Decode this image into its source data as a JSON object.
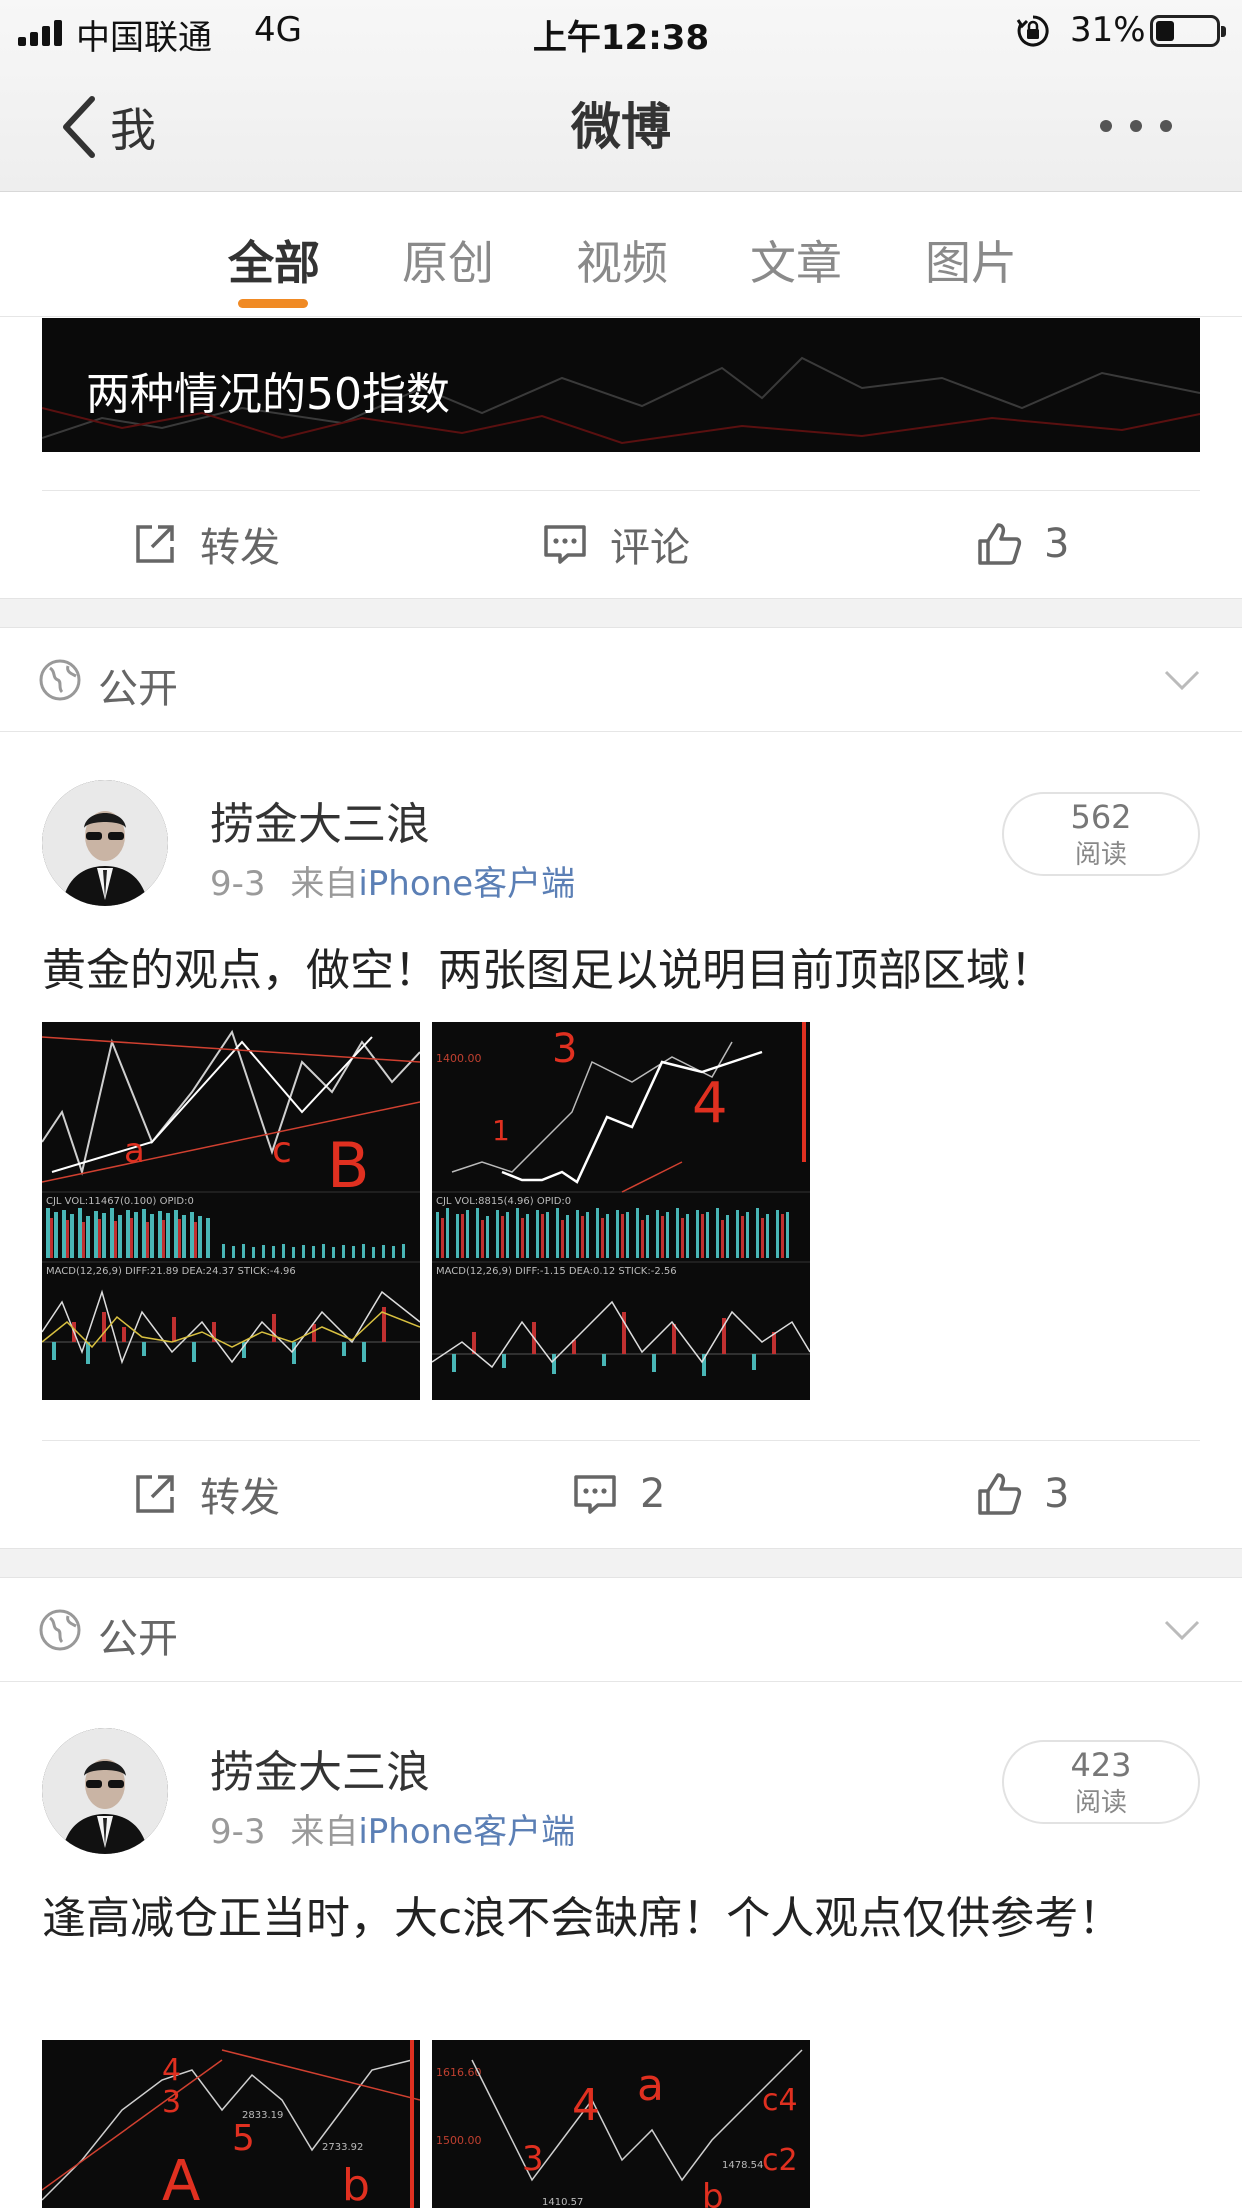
{
  "status_bar": {
    "carrier": "中国联通",
    "network": "4G",
    "time": "上午12:38",
    "battery": "31%",
    "battery_level": 0.31
  },
  "nav": {
    "back_label": "我",
    "title": "微博"
  },
  "tabs": [
    {
      "label": "全部",
      "active": true
    },
    {
      "label": "原创",
      "active": false
    },
    {
      "label": "视频",
      "active": false
    },
    {
      "label": "文章",
      "active": false
    },
    {
      "label": "图片",
      "active": false
    }
  ],
  "accent_color": "#f08a24",
  "link_color": "#5b7fb5",
  "banner": {
    "text": "两种情况的50指数"
  },
  "first_actions": {
    "repost": "转发",
    "comment": "评论",
    "like_count": "3"
  },
  "posts": [
    {
      "visibility": "公开",
      "author": "捞金大三浪",
      "date": "9-3",
      "source_prefix": "来自",
      "source": "iPhone客户端",
      "read_count": "562",
      "read_label": "阅读",
      "text": "黄金的观点，做空！两张图足以说明目前顶部区域！",
      "repost": "转发",
      "comment_count": "2",
      "like_count": "3"
    },
    {
      "visibility": "公开",
      "author": "捞金大三浪",
      "date": "9-3",
      "source_prefix": "来自",
      "source": "iPhone客户端",
      "read_count": "423",
      "read_label": "阅读",
      "text": "逢高减仓正当时，大c浪不会缺席！个人观点仅供参考！"
    }
  ],
  "icons": [
    "signal-icon",
    "lock-rotation-icon",
    "battery-icon",
    "back-chevron-icon",
    "more-icon",
    "repost-icon",
    "comment-icon",
    "like-icon",
    "globe-icon",
    "chevron-down-icon"
  ]
}
